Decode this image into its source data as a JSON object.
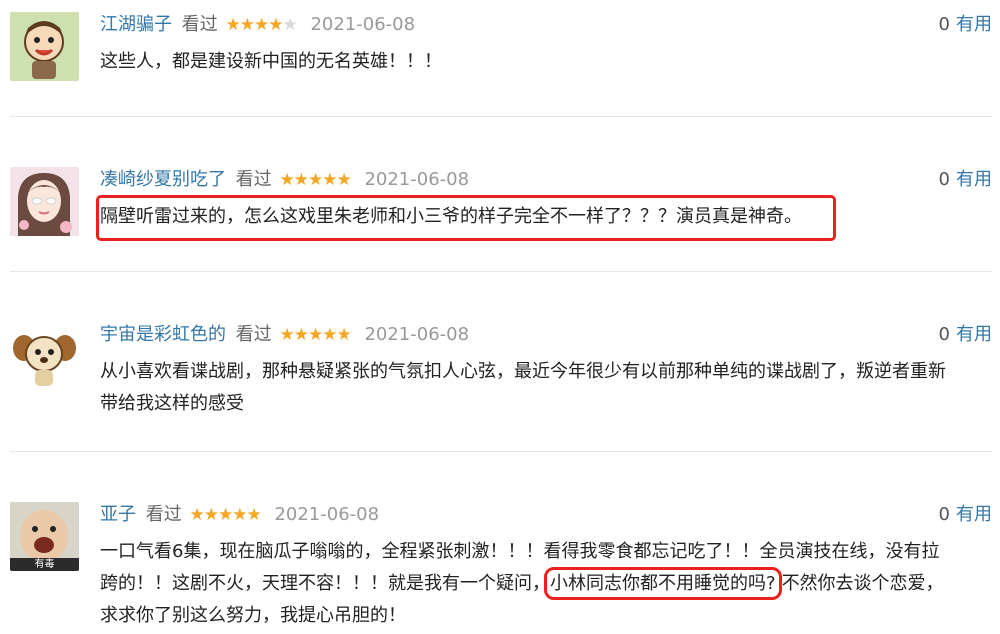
{
  "accent_colors": {
    "link": "#3377aa",
    "star": "#f5a623",
    "highlight": "#e8221d"
  },
  "comments": [
    {
      "user": "江湖骗子",
      "watched": "看过",
      "rating": 4,
      "date": "2021-06-08",
      "useful_count": "0",
      "useful_label": "有用",
      "text": "这些人，都是建设新中国的无名英雄！！！"
    },
    {
      "user": "凑崎纱夏别吃了",
      "watched": "看过",
      "rating": 5,
      "date": "2021-06-08",
      "useful_count": "0",
      "useful_label": "有用",
      "text": "隔壁听雷过来的，怎么这戏里朱老师和小三爷的样子完全不一样了？？？演员真是神奇。"
    },
    {
      "user": "宇宙是彩虹色的",
      "watched": "看过",
      "rating": 5,
      "date": "2021-06-08",
      "useful_count": "0",
      "useful_label": "有用",
      "text_line1": "从小喜欢看谍战剧，那种悬疑紧张的气氛扣人心弦，最近今年很少有以前那种单纯的谍战剧了，叛逆者重新",
      "text_line2": "带给我这样的感受"
    },
    {
      "user": "亚子",
      "watched": "看过",
      "rating": 5,
      "date": "2021-06-08",
      "useful_count": "0",
      "useful_label": "有用",
      "text_line1": "一口气看6集，现在脑瓜子嗡嗡的，全程紧张刺激！！！看得我零食都忘记吃了！！全员演技在线，没有拉",
      "text_line2a": "跨的！！这剧不火，天理不容！！！就是我有一个疑问，",
      "text_line2b": "小林同志你都不用睡觉的吗?",
      "text_line2c": "不然你去谈个恋爱，",
      "text_line3": "求求你了别这么努力，我提心吊胆的！",
      "avatar_caption": "有毒"
    }
  ]
}
